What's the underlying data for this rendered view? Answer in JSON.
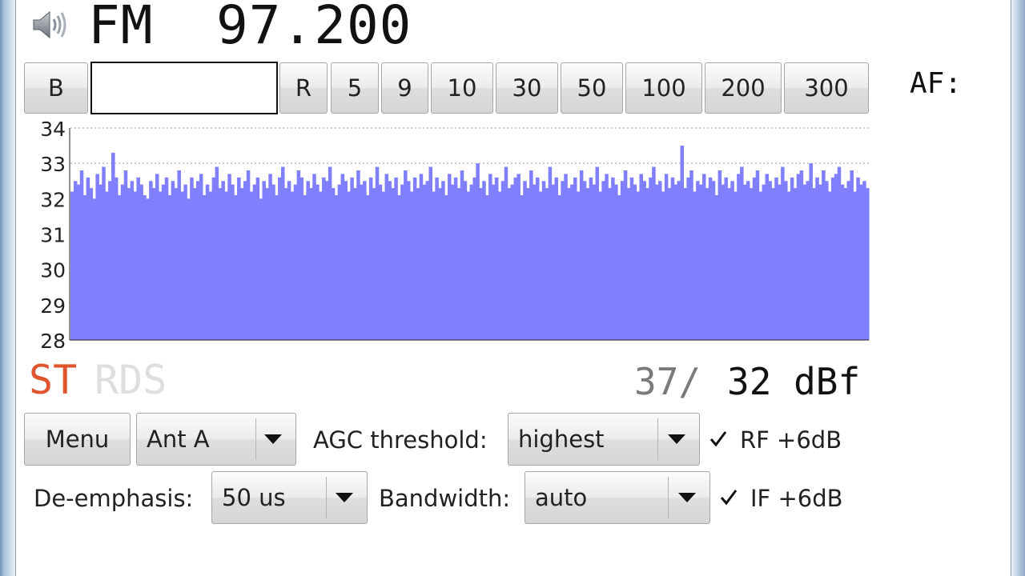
{
  "header": {
    "band": "FM",
    "frequency": "97.200",
    "af_label": "AF:"
  },
  "tuning": {
    "buttons": [
      "B",
      "R",
      "5",
      "9",
      "10",
      "30",
      "50",
      "100",
      "200",
      "300"
    ],
    "input_value": ""
  },
  "spectrum": {
    "y_ticks": [
      "34",
      "33",
      "32",
      "31",
      "30",
      "29",
      "28"
    ],
    "bar_color": "#8080ff"
  },
  "status": {
    "stereo": "ST",
    "rds": "RDS",
    "signal_avg": "37/",
    "signal_current": "32 dBf"
  },
  "controls": {
    "menu_label": "Menu",
    "antenna": "Ant A",
    "agc_label": "AGC threshold:",
    "agc_value": "highest",
    "rf_label": "RF +6dB",
    "rf_checked": true,
    "deemphasis_label": "De-emphasis:",
    "deemphasis_value": "50 us",
    "bandwidth_label": "Bandwidth:",
    "bandwidth_value": "auto",
    "if_label": "IF +6dB",
    "if_checked": true
  },
  "chart_data": {
    "type": "bar",
    "ylim": [
      28,
      34
    ],
    "y_ticks": [
      34,
      33,
      32,
      31,
      30,
      29,
      28
    ],
    "grid": "dotted horizontal at 33 and 34",
    "series": [
      {
        "values": [
          32.2,
          32.5,
          32.4,
          32.8,
          32.1,
          32.6,
          32.3,
          32.0,
          32.7,
          32.4,
          32.9,
          32.2,
          32.5,
          33.3,
          32.6,
          32.1,
          32.4,
          32.8,
          32.3,
          32.5,
          32.2,
          32.6,
          32.4,
          32.1,
          32.0,
          32.5,
          32.3,
          32.7,
          32.2,
          32.4,
          32.6,
          32.1,
          32.5,
          32.3,
          32.8,
          32.2,
          32.4,
          32.0,
          32.6,
          32.3,
          32.5,
          32.7,
          32.1,
          32.4,
          32.2,
          32.6,
          32.9,
          32.3,
          32.5,
          32.2,
          32.7,
          32.4,
          32.1,
          32.6,
          32.3,
          32.5,
          32.8,
          32.2,
          32.4,
          32.6,
          32.0,
          32.5,
          32.3,
          32.7,
          32.4,
          32.1,
          32.6,
          32.9,
          32.3,
          32.5,
          32.2,
          32.4,
          32.8,
          32.6,
          32.1,
          32.5,
          32.3,
          32.7,
          32.4,
          32.2,
          32.6,
          32.5,
          32.9,
          32.3,
          32.1,
          32.4,
          32.7,
          32.5,
          32.2,
          32.6,
          32.3,
          32.8,
          32.4,
          32.5,
          32.1,
          32.6,
          32.3,
          32.9,
          32.4,
          32.2,
          32.7,
          32.5,
          32.3,
          32.6,
          32.1,
          32.4,
          32.8,
          32.5,
          32.2,
          32.6,
          32.3,
          32.7,
          32.4,
          32.5,
          32.9,
          32.2,
          32.6,
          32.3,
          32.5,
          32.1,
          32.7,
          32.4,
          32.6,
          32.3,
          32.8,
          32.5,
          32.2,
          32.4,
          32.6,
          33.0,
          32.3,
          32.5,
          32.1,
          32.7,
          32.4,
          32.6,
          32.2,
          32.5,
          32.9,
          32.3,
          32.4,
          32.6,
          32.7,
          32.1,
          32.5,
          32.3,
          32.8,
          32.4,
          32.6,
          32.2,
          32.5,
          32.3,
          32.9,
          32.4,
          32.6,
          32.1,
          32.5,
          32.7,
          32.3,
          32.4,
          32.6,
          32.2,
          32.8,
          32.5,
          32.3,
          32.6,
          32.4,
          32.9,
          32.2,
          32.5,
          32.7,
          32.3,
          32.6,
          32.4,
          32.1,
          32.5,
          32.8,
          32.3,
          32.6,
          32.4,
          32.2,
          32.7,
          32.5,
          32.3,
          32.6,
          32.9,
          32.4,
          32.5,
          32.2,
          32.7,
          32.3,
          32.6,
          32.4,
          32.5,
          33.5,
          32.3,
          32.6,
          32.8,
          32.2,
          32.5,
          32.4,
          32.7,
          32.3,
          32.6,
          32.5,
          32.1,
          32.8,
          32.4,
          32.6,
          32.3,
          32.5,
          32.2,
          32.7,
          32.9,
          32.4,
          32.5,
          32.3,
          32.6,
          32.8,
          32.2,
          32.4,
          32.7,
          32.5,
          32.3,
          32.6,
          32.4,
          32.9,
          32.5,
          32.2,
          32.6,
          32.3,
          32.7,
          32.8,
          32.4,
          32.5,
          33.0,
          32.3,
          32.6,
          32.4,
          32.8,
          32.5,
          32.2,
          32.6,
          32.7,
          32.9,
          32.4,
          32.3,
          32.5,
          32.8,
          32.2,
          32.6,
          32.4,
          32.5,
          32.3
        ]
      }
    ]
  }
}
